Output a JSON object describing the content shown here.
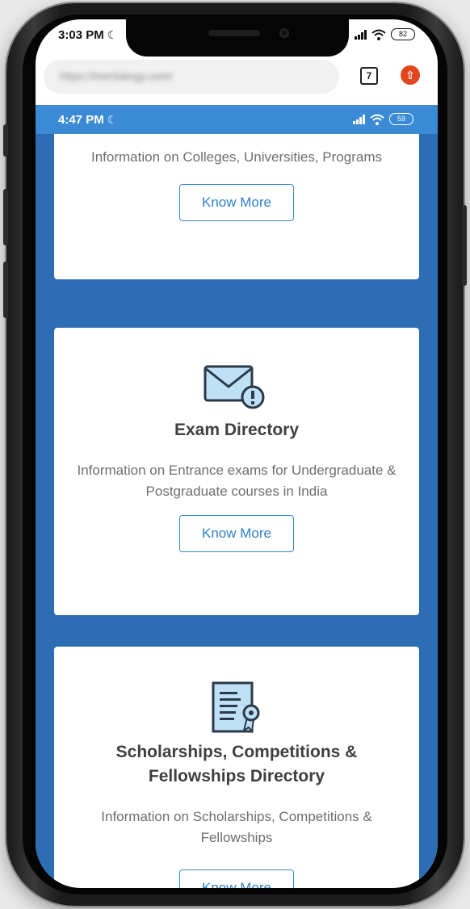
{
  "outer_status": {
    "time": "3:03 PM",
    "battery": "82"
  },
  "browser": {
    "url": "https://mentalogy.com/",
    "tab_count": "7"
  },
  "inner_status": {
    "time": "4:47 PM",
    "battery": "59"
  },
  "cards": [
    {
      "title": "",
      "description": "Information on Colleges, Universities, Programs",
      "button": "Know More"
    },
    {
      "title": "Exam Directory",
      "description": "Information on Entrance exams for Undergraduate & Postgraduate courses in India",
      "button": "Know More",
      "icon": "envelope-alert-icon"
    },
    {
      "title": "Scholarships, Competitions & Fellowships Directory",
      "description": "Information on Scholarships, Competitions & Fellowships",
      "button": "Know More",
      "icon": "certificate-icon"
    }
  ],
  "colors": {
    "accent": "#3b8ad6",
    "background": "#2c6db3",
    "button_border": "#3a8bd0",
    "upload_button": "#e2461d"
  }
}
